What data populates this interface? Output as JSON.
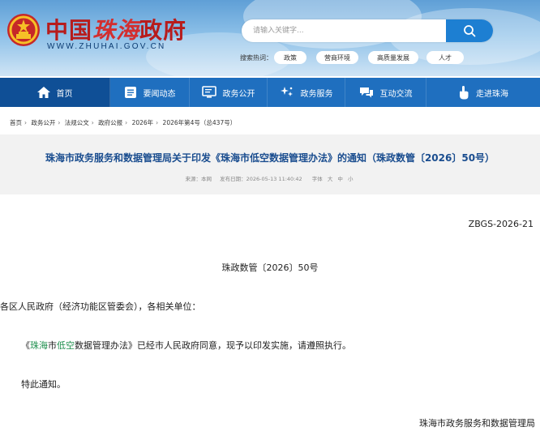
{
  "header": {
    "site_title_pre": "中国",
    "site_title_mid": "珠海",
    "site_title_post": "政府",
    "site_url": "WWW.ZHUHAI.GOV.CN",
    "search_placeholder": "请输入关键字...",
    "hot_label": "搜索热词：",
    "hot_tags": [
      "政策",
      "营商环境",
      "高质量发展",
      "人才"
    ]
  },
  "nav": {
    "items": [
      {
        "label": "首页",
        "icon": "home-icon"
      },
      {
        "label": "要闻动态",
        "icon": "news-list-icon"
      },
      {
        "label": "政务公开",
        "icon": "monitor-list-icon"
      },
      {
        "label": "政务服务",
        "icon": "service-sparkle-icon"
      },
      {
        "label": "互动交流",
        "icon": "chat-bubbles-icon"
      },
      {
        "label": "走进珠海",
        "icon": "pointer-hand-icon"
      }
    ]
  },
  "breadcrumb": [
    "首页",
    "政务公开",
    "法规公文",
    "政府公报",
    "2026年",
    "2026年第4号（总437号）"
  ],
  "article": {
    "title": "珠海市政务服务和数据管理局关于印发《珠海市低空数据管理办法》的通知（珠政数管〔2026〕50号）",
    "source": "来源：本网",
    "publish": "发布日期：2026-05-13 11:40:42",
    "font_label": "字体",
    "font_sizes": [
      "大",
      "中",
      "小"
    ]
  },
  "doc": {
    "code": "ZBGS-2026-21",
    "number": "珠政数管〔2026〕50号",
    "salutation": "各区人民政府（经济功能区管委会），各相关单位：",
    "para_open": "《",
    "para_kw1": "珠海",
    "para_mid1": "市",
    "para_kw2": "低空",
    "para_rest": "数据管理办法》已经市人民政府同意，现予以印发实施，请遵照执行。",
    "closing": "特此通知。",
    "signature": "珠海市政务服务和数据管理局"
  },
  "colors": {
    "nav_bg": "#1f6fbf",
    "nav_active": "#0f4f96",
    "title": "#1a4d8f",
    "keyword": "#1f8f4e",
    "brand_red": "#b71c1c"
  }
}
